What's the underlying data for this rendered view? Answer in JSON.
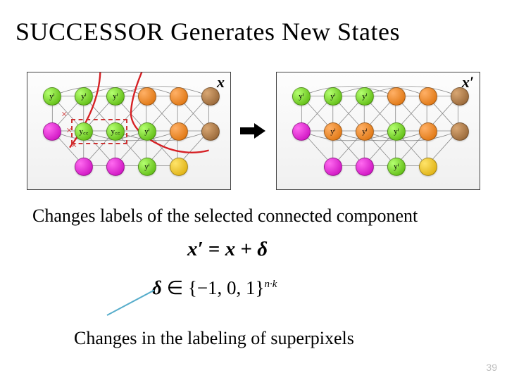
{
  "title": "SUCCESSOR Generates New States",
  "panels": {
    "left_label": "x",
    "right_label": "x′"
  },
  "caption1": "Changes labels of the selected connected component",
  "equation1": {
    "lhs": "x′",
    "rhs_a": "x",
    "rhs_b": "δ"
  },
  "equation2": {
    "delta": "δ",
    "set": "{−1, 0, 1}",
    "exp": "n·k"
  },
  "caption2": "Changes in the labeling of superpixels",
  "page_number": "39",
  "node_labels": {
    "yi": "yⁱ",
    "ycc": "y꜀꜀"
  }
}
